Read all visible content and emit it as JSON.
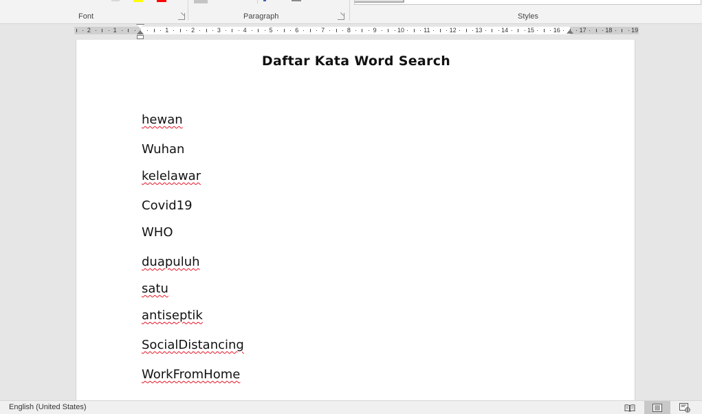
{
  "ribbon": {
    "groups": [
      {
        "label": "Font"
      },
      {
        "label": "Paragraph"
      },
      {
        "label": "Styles"
      }
    ],
    "highlight_color": "#ffff00",
    "font_color": "#ff0000"
  },
  "ruler": {
    "left_numbers": [
      "2",
      "1"
    ],
    "right_numbers": [
      "1",
      "2",
      "3",
      "4",
      "5",
      "6",
      "7",
      "8",
      "9",
      "10",
      "11",
      "12",
      "13",
      "14",
      "15",
      "16",
      "17",
      "18",
      "19"
    ]
  },
  "document": {
    "title": "Daftar Kata Word Search",
    "words": [
      {
        "text": "hewan",
        "spell_error": true
      },
      {
        "text": "Wuhan",
        "spell_error": false
      },
      {
        "text": "kelelawar",
        "spell_error": true
      },
      {
        "text": "Covid19",
        "spell_error": false
      },
      {
        "text": "WHO",
        "spell_error": false
      },
      {
        "text": "duapuluh",
        "spell_error": true
      },
      {
        "text": "satu",
        "spell_error": true
      },
      {
        "text": "antiseptik",
        "spell_error": true
      },
      {
        "text": "SocialDistancing",
        "spell_error": true
      },
      {
        "text": "WorkFromHome",
        "spell_error": true
      }
    ]
  },
  "status_bar": {
    "language": "English (United States)",
    "views": [
      {
        "icon": "read-mode-icon",
        "active": false
      },
      {
        "icon": "print-layout-icon",
        "active": true
      },
      {
        "icon": "web-layout-icon",
        "active": false
      }
    ]
  }
}
